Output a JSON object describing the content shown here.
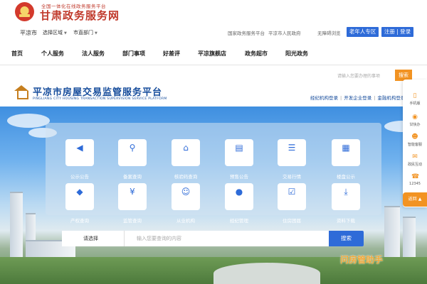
{
  "header": {
    "subtitle": "全国一体化在线政务服务平台",
    "title": "甘肃政务服务网"
  },
  "location": {
    "city": "平凉市",
    "area_select": "选择区域",
    "dept_select": "市直部门"
  },
  "utility": {
    "national": "国家政务服务平台",
    "city_gov": "平凉市人民政府",
    "accessible": "无障碍浏览",
    "elder_button": "老年人专区",
    "login_button": "注册 | 登录"
  },
  "nav": {
    "items": [
      {
        "label": "首页"
      },
      {
        "label": "个人服务"
      },
      {
        "label": "法人服务"
      },
      {
        "label": "部门事项"
      },
      {
        "label": "好差评"
      },
      {
        "label": "平凉旗舰店"
      },
      {
        "label": "政务超市"
      },
      {
        "label": "阳光政务"
      }
    ]
  },
  "platform": {
    "search_placeholder": "请输入您要办理的事项",
    "search_button": "搜索",
    "title": "平凉市房屋交易监管服务平台",
    "title_en": "PINGLIANG CITY HOUSING TRANSACTION SUPERVISION SERVICE PLATFORM",
    "links": [
      "经纪机构登录",
      "开发企业登录",
      "金融机构登录"
    ]
  },
  "services": {
    "row1": [
      {
        "label": "公示公告",
        "icon": "speaker-icon"
      },
      {
        "label": "备案查询",
        "icon": "search-person-icon"
      },
      {
        "label": "核验码查询",
        "icon": "house-icon"
      },
      {
        "label": "预售公告",
        "icon": "clipboard-icon"
      },
      {
        "label": "交易行情",
        "icon": "coins-icon"
      },
      {
        "label": "楼盘公示",
        "icon": "building-icon"
      }
    ],
    "row2": [
      {
        "label": "产权查询",
        "icon": "shield-icon"
      },
      {
        "label": "监管查询",
        "icon": "yen-icon"
      },
      {
        "label": "从业机构",
        "icon": "people-icon"
      },
      {
        "label": "经纪管理",
        "icon": "agent-icon"
      },
      {
        "label": "住房困届",
        "icon": "checklist-icon"
      },
      {
        "label": "资料下载",
        "icon": "download-icon"
      }
    ]
  },
  "search": {
    "select_label": "请选择",
    "placeholder": "输入您要查询的内容",
    "button": "搜索"
  },
  "helper_text": "问房管助手",
  "sidebar": {
    "items": [
      {
        "label": "手机版",
        "icon": "phone-icon"
      },
      {
        "label": "甘快办",
        "icon": "app-icon"
      },
      {
        "label": "智能客服",
        "icon": "robot-icon"
      },
      {
        "label": "政民互动",
        "icon": "chat-icon"
      },
      {
        "label": "12345",
        "icon": "hotline-icon"
      }
    ],
    "top_label": "返回"
  },
  "colors": {
    "brand_red": "#c0392b",
    "primary_blue": "#2e6bd8",
    "platform_blue": "#174d9c",
    "accent_orange": "#f29322"
  }
}
